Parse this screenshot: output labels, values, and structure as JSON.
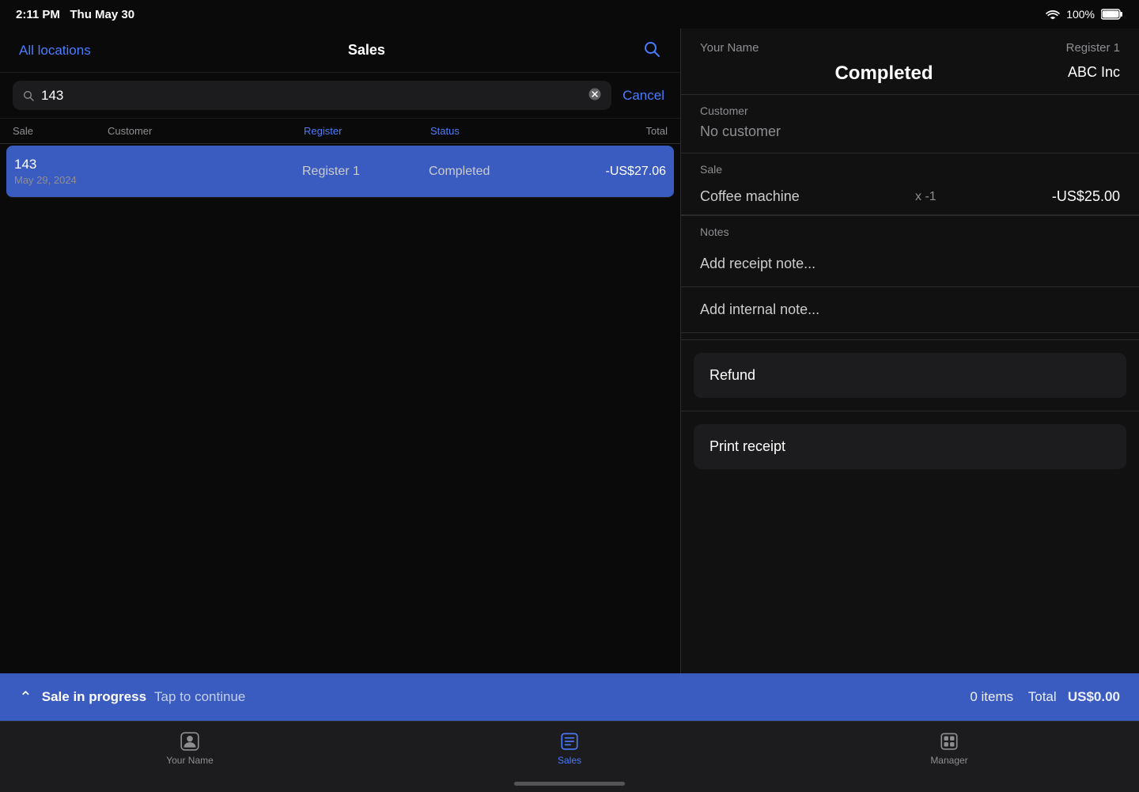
{
  "status_bar": {
    "time": "2:11 PM",
    "date": "Thu May 30",
    "battery": "100%"
  },
  "left_panel": {
    "all_locations_label": "All locations",
    "title": "Sales",
    "search_value": "143",
    "cancel_label": "Cancel",
    "table": {
      "headers": [
        {
          "label": "Sale",
          "style": "normal"
        },
        {
          "label": "Customer",
          "style": "normal"
        },
        {
          "label": "Register",
          "style": "blue"
        },
        {
          "label": "Status",
          "style": "blue"
        },
        {
          "label": "Total",
          "style": "right"
        }
      ],
      "rows": [
        {
          "sale_number": "143",
          "sale_date": "May 29, 2024",
          "customer": "",
          "register": "Register 1",
          "status": "Completed",
          "total": "-US$27.06",
          "selected": true
        }
      ]
    }
  },
  "right_panel": {
    "header": {
      "your_name": "Your Name",
      "register": "Register 1",
      "title": "Completed",
      "company": "ABC Inc"
    },
    "customer_section": {
      "label": "Customer",
      "value": "No customer"
    },
    "sale_section": {
      "label": "Sale",
      "item_name": "Coffee machine",
      "item_qty": "x -1",
      "item_price": "-US$25.00"
    },
    "notes_section": {
      "label": "Notes",
      "receipt_note_label": "Add receipt note...",
      "internal_note_label": "Add internal note..."
    },
    "refund_label": "Refund",
    "print_receipt_label": "Print receipt"
  },
  "bottom_bar": {
    "chevron": "⌃",
    "sale_in_progress": "Sale in progress",
    "tap_to_continue": "Tap to continue",
    "items_count": "0 items",
    "total_label": "Total",
    "total_value": "US$0.00"
  },
  "tab_bar": {
    "items": [
      {
        "label": "Your Name",
        "icon": "person",
        "active": false
      },
      {
        "label": "Sales",
        "icon": "list",
        "active": true
      },
      {
        "label": "Manager",
        "icon": "grid",
        "active": false
      }
    ]
  }
}
